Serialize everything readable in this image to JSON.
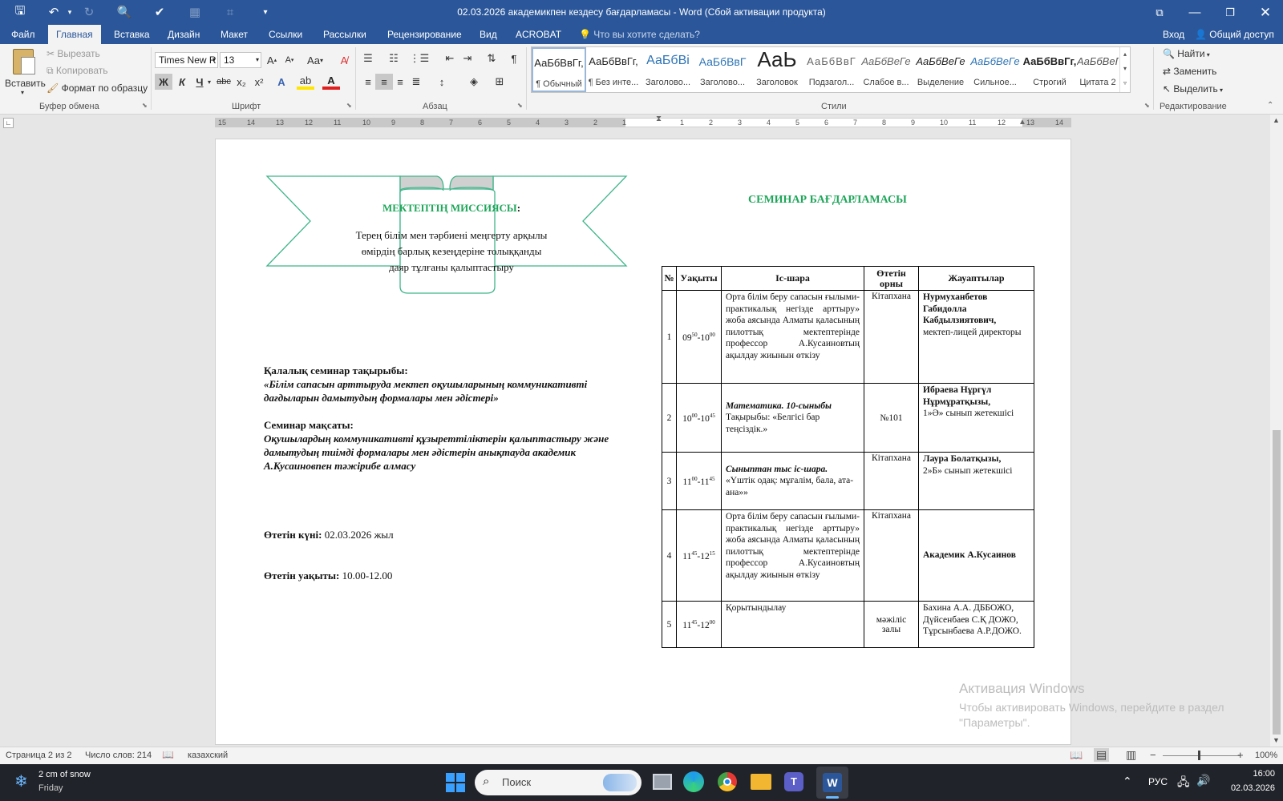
{
  "titlebar": {
    "title": "02.03.2026 академикпен кездесу бағдарламасы - Word (Сбой активации продукта)"
  },
  "tabs": [
    "Файл",
    "Главная",
    "Вставка",
    "Дизайн",
    "Макет",
    "Ссылки",
    "Рассылки",
    "Рецензирование",
    "Вид",
    "ACROBAT"
  ],
  "active_tab": "Главная",
  "tell_me": "Что вы хотите сделать?",
  "account": {
    "signin": "Вход",
    "share": "Общий доступ"
  },
  "ribbon": {
    "clipboard": {
      "label": "Буфер обмена",
      "paste": "Вставить",
      "cut": "Вырезать",
      "copy": "Копировать",
      "format_painter": "Формат по образцу"
    },
    "font": {
      "label": "Шрифт",
      "name": "Times New R",
      "size": "13",
      "case": "Aa",
      "bold": "Ж",
      "italic": "К",
      "underline": "Ч",
      "strike": "abc",
      "sub": "x₂",
      "sup": "x²"
    },
    "paragraph": {
      "label": "Абзац"
    },
    "styles": {
      "label": "Стили",
      "items": [
        {
          "preview": "АаБбВвГг,",
          "name": "¶ Обычный"
        },
        {
          "preview": "АаБбВвГг,",
          "name": "¶ Без инте..."
        },
        {
          "preview": "АаБбВі",
          "name": "Заголово..."
        },
        {
          "preview": "АаБбВвГ",
          "name": "Заголово..."
        },
        {
          "preview": "АаЬ",
          "name": "Заголовок"
        },
        {
          "preview": "АаБбВвГ",
          "name": "Подзагол..."
        },
        {
          "preview": "АаБбВеГе",
          "name": "Слабое в..."
        },
        {
          "preview": "АаБбВеГе",
          "name": "Выделение"
        },
        {
          "preview": "АаБбВеГе",
          "name": "Сильное..."
        },
        {
          "preview": "АаБбВвГг,",
          "name": "Строгий"
        },
        {
          "preview": "АаБбВеГе",
          "name": "Цитата 2"
        }
      ]
    },
    "editing": {
      "label": "Редактирование",
      "find": "Найти",
      "replace": "Заменить",
      "select": "Выделить"
    }
  },
  "ruler": {
    "left": [
      "15",
      "14",
      "13",
      "12",
      "11",
      "10",
      "9",
      "8",
      "7",
      "6",
      "5",
      "4",
      "3",
      "2",
      "1"
    ],
    "right": [
      "1",
      "2",
      "3",
      "4",
      "5",
      "6",
      "7",
      "8",
      "9",
      "10",
      "11",
      "12",
      "13",
      "14"
    ]
  },
  "document": {
    "mission": {
      "title": "МЕКТЕПТІҢ МИССИЯСЫ",
      "colon": ":",
      "text": "Терең білім мен тәрбиені меңгерту арқылы өмірдің барлық кезеңдеріне толыққанды даяр тұлғаны қалыптастыру"
    },
    "topic_label": "Қалалық семинар тақырыбы:",
    "topic": "«Білім сапасын арттыруда  мектеп оқушыларының коммуникативті дағдыларын дамытудың формалары мен әдістері»",
    "goal_label": "Семинар мақсаты:",
    "goal": "Оқушылардың коммуникативті құзыреттіліктерін қалыптастыру және дамытудың тиімді формалары мен әдістерін анықтауда  академик А.Кусаиновпен тәжірибе алмасу",
    "date_label": "Өтетін күні:",
    "date": "02.03.2026 жыл",
    "time_label": "Өтетін уақыты:",
    "time": "10.00-12.00",
    "program_title": "СЕМИНАР БАҒДАРЛАМАСЫ",
    "table": {
      "headers": [
        "№",
        "Уақыты",
        "Іс-шара",
        "Өтетін орны",
        "Жауаптылар"
      ],
      "rows": [
        {
          "n": "1",
          "t1": "09",
          "s1": "50",
          "t2": "-10",
          "s2": "00",
          "event_em": "",
          "event": "Орта білім беру сапасын ғылыми-практикалық негізде арттыру» жоба аясында Алматы қаласының пилоттық мектептерінде профессор А.Кусаиновтың ақылдау жиынын өткізу",
          "place": "Кітапхана",
          "resp_b": "Нурмуханбетов Габидолла Кабдылзиятович,",
          "resp": "мектеп-лицей директоры"
        },
        {
          "n": "2",
          "t1": "10",
          "s1": "00",
          "t2": "-10",
          "s2": "45",
          "event_em": "Математика. 10-сыныбы",
          "event": "Тақырыбы: «Белгісі бар теңсіздік.»",
          "place": "№101",
          "resp_b": "Ибраева Нұргүл Нұрмұратқызы,",
          "resp": "1»Ә» сынып жетекшісі"
        },
        {
          "n": "3",
          "t1": "11",
          "s1": "00",
          "t2": "-11",
          "s2": "45",
          "event_em": "Сыныптан тыс іс-шара.",
          "event": "«Үштік одақ: мұғалім, бала, ата-ана»»",
          "place": "Кітапхана",
          "resp_b": "Лаура Болатқызы,",
          "resp": "2»Б» сынып жетекшісі"
        },
        {
          "n": "4",
          "t1": "11",
          "s1": "45",
          "t2": "-12",
          "s2": "15",
          "event_em": "",
          "event": "Орта білім беру сапасын ғылыми-практикалық негізде арттыру» жоба аясында Алматы қаласының пилоттық мектептерінде профессор А.Кусаиновтың ақылдау жиынын өткізу",
          "place": "Кітапхана",
          "resp_b": "Академик А.Кусаинов",
          "resp": ""
        },
        {
          "n": "5",
          "t1": "11",
          "s1": "45",
          "t2": "-12",
          "s2": "00",
          "event_em": "",
          "event": "Қорытындылау",
          "place": "мәжіліс залы",
          "resp_b": "",
          "resp": "Бахина А.А. ДББОЖО, Дүйсенбаев С.Қ ДОЖО, Тұрсынбаева А.Р.ДОЖО."
        }
      ]
    }
  },
  "watermark": {
    "title": "Активация Windows",
    "text": "Чтобы активировать Windows, перейдите в раздел \"Параметры\"."
  },
  "status": {
    "page": "Страница 2 из 2",
    "words": "Число слов: 214",
    "lang": "казахский",
    "zoom": "100%"
  },
  "taskbar": {
    "weather": "2 cm of snow",
    "day": "Friday",
    "search": "Поиск",
    "lang": "РУС",
    "time": "16:00",
    "date": "02.03.2026"
  }
}
